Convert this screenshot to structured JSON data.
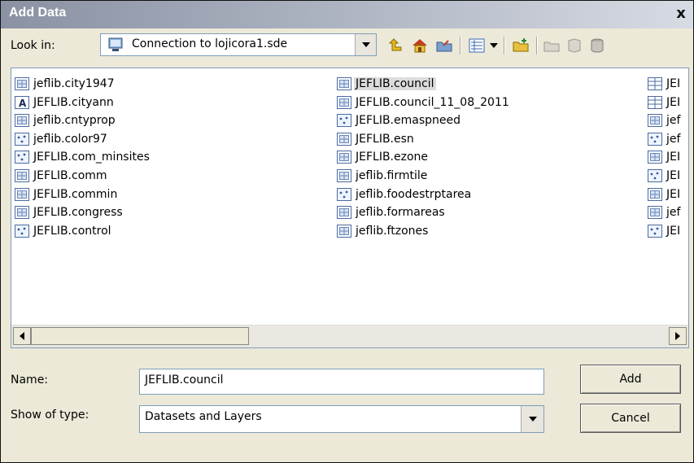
{
  "dialog": {
    "title": "Add Data",
    "close_label": "x"
  },
  "look_in": {
    "label": "Look in:",
    "value": "Connection to lojicora1.sde"
  },
  "toolbar": {
    "icons": [
      "up-one-level-icon",
      "home-icon",
      "connect-folder-icon",
      "view-list-icon",
      "view-menu-dropdown-icon",
      "new-database-icon",
      "new-folder-icon",
      "new-catalog-icon",
      "geodatabase-icon"
    ]
  },
  "list": {
    "columns": [
      [
        {
          "name": "jeflib.city1947",
          "icon": "raster-icon"
        },
        {
          "name": "JEFLIB.cityann",
          "icon": "annotation-icon"
        },
        {
          "name": "jeflib.cntyprop",
          "icon": "raster-icon"
        },
        {
          "name": "jeflib.color97",
          "icon": "point-feature-icon"
        },
        {
          "name": "JEFLIB.com_minsites",
          "icon": "point-feature-icon"
        },
        {
          "name": "JEFLIB.comm",
          "icon": "raster-icon"
        },
        {
          "name": "JEFLIB.commin",
          "icon": "raster-icon"
        },
        {
          "name": "JEFLIB.congress",
          "icon": "raster-icon"
        },
        {
          "name": "JEFLIB.control",
          "icon": "point-feature-icon"
        }
      ],
      [
        {
          "name": "JEFLIB.council",
          "icon": "raster-icon",
          "selected": true
        },
        {
          "name": "JEFLIB.council_11_08_2011",
          "icon": "raster-icon"
        },
        {
          "name": "JEFLIB.emaspneed",
          "icon": "point-feature-icon"
        },
        {
          "name": "JEFLIB.esn",
          "icon": "raster-icon"
        },
        {
          "name": "JEFLIB.ezone",
          "icon": "raster-icon"
        },
        {
          "name": "jeflib.firmtile",
          "icon": "raster-icon"
        },
        {
          "name": "jeflib.foodestrptarea",
          "icon": "point-feature-icon"
        },
        {
          "name": "jeflib.formareas",
          "icon": "raster-icon"
        },
        {
          "name": "jeflib.ftzones",
          "icon": "raster-icon"
        }
      ],
      [
        {
          "name": "JEI",
          "icon": "table-icon"
        },
        {
          "name": "JEI",
          "icon": "table-icon"
        },
        {
          "name": "jef",
          "icon": "raster-icon"
        },
        {
          "name": "jef",
          "icon": "point-feature-icon"
        },
        {
          "name": "JEI",
          "icon": "raster-icon"
        },
        {
          "name": "JEI",
          "icon": "point-feature-icon"
        },
        {
          "name": "JEI",
          "icon": "raster-icon"
        },
        {
          "name": "jef",
          "icon": "raster-icon"
        },
        {
          "name": "JEI",
          "icon": "point-feature-icon"
        }
      ]
    ]
  },
  "name_field": {
    "label": "Name:",
    "value": "JEFLIB.council"
  },
  "type_field": {
    "label": "Show of type:",
    "value": "Datasets and Layers"
  },
  "buttons": {
    "add": "Add",
    "cancel": "Cancel"
  },
  "colors": {
    "title_bar_start": "#8a92a3",
    "title_bar_end": "#d7dbe3",
    "dialog_bg": "#ece9d8",
    "field_border": "#7f9db9"
  }
}
